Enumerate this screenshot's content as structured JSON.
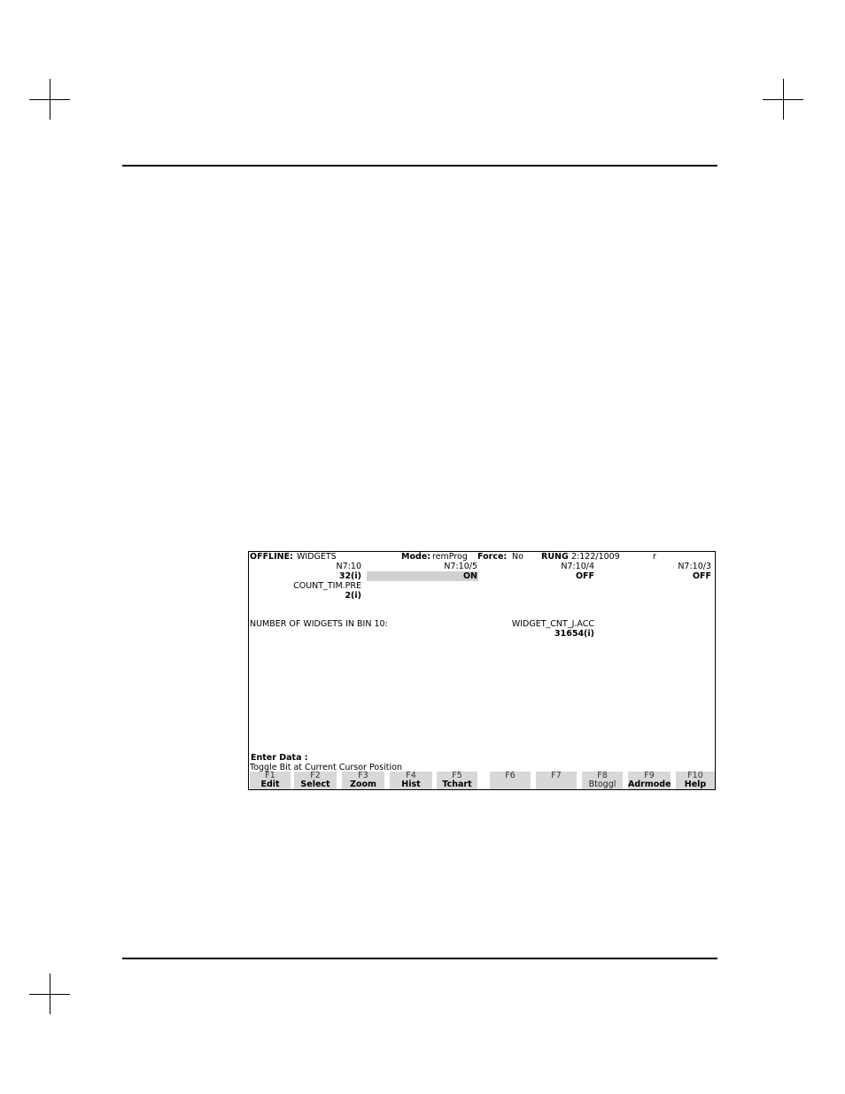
{
  "status": {
    "offline_label": "OFFLINE:",
    "file": "WIDGETS",
    "mode_label": "Mode:",
    "mode_value": "remProg",
    "force_label": "Force:",
    "force_value": "No",
    "rung_label": "RUNG",
    "rung_value": "2:122/1009",
    "flag": "r"
  },
  "monitor": {
    "addr1": "N7:10",
    "val1": "32(i)",
    "addr2": "N7:10/5",
    "val2": "ON",
    "addr3": "N7:10/4",
    "val3": "OFF",
    "addr4": "N7:10/3",
    "val4": "OFF",
    "preset_label": "COUNT_TIM.PRE",
    "preset_value": "2(i)",
    "comment": "NUMBER OF WIDGETS IN BIN 10:",
    "acc_label": "WIDGET_CNT_J.ACC",
    "acc_value": "31654(i)"
  },
  "prompt": {
    "enter_data": "Enter Data :",
    "help_line": "Toggle Bit at Current Cursor Position"
  },
  "fkeys": [
    {
      "key": "F1",
      "label": "Edit"
    },
    {
      "key": "F2",
      "label": "Select"
    },
    {
      "key": "F3",
      "label": "Zoom"
    },
    {
      "key": "F4",
      "label": "Hist"
    },
    {
      "key": "F5",
      "label": "Tchart"
    },
    {
      "key": "F6",
      "label": ""
    },
    {
      "key": "F7",
      "label": ""
    },
    {
      "key": "F8",
      "label": "Btoggl"
    },
    {
      "key": "F9",
      "label": "Adrmode"
    },
    {
      "key": "F10",
      "label": "Help"
    }
  ]
}
